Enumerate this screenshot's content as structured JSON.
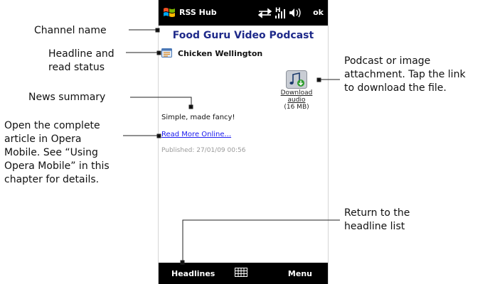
{
  "status_bar": {
    "app_title": "RSS Hub",
    "network_letter": "H",
    "ok_label": "ok"
  },
  "feed": {
    "channel_name": "Food Guru Video Podcast",
    "headline": "Chicken Wellington",
    "summary": "Simple, made fancy!",
    "read_more_label": "Read More Online...",
    "published": "Published: 27/01/09 00:56",
    "attachment": {
      "link_label": "Download audio",
      "size_label": "(16 MB)"
    }
  },
  "softkeys": {
    "left": "Headlines",
    "right": "Menu"
  },
  "callouts": {
    "channel_name": "Channel name",
    "headline_status": [
      "Headline and",
      "read status"
    ],
    "news_summary": "News summary",
    "open_article": [
      "Open the complete",
      "article in Opera",
      "Mobile. See “Using",
      "Opera Mobile” in this",
      "chapter for details."
    ],
    "attachment": [
      "Podcast or image",
      "attachment. Tap the link",
      "to download the file."
    ],
    "return_list": [
      "Return to the",
      "headline list"
    ]
  }
}
